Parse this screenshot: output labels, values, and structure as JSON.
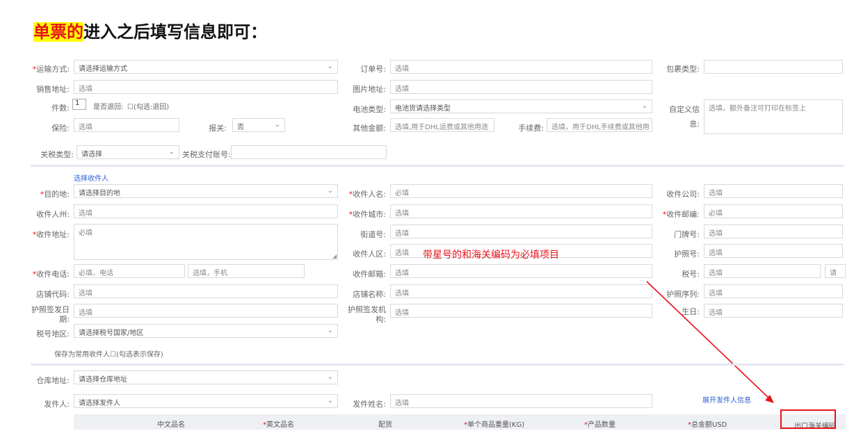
{
  "headline": {
    "highlight": "单票的",
    "rest": "进入之后填写信息即可："
  },
  "star": "*",
  "row1": {
    "transport_label": "运输方式:",
    "transport_value": "请选择运输方式",
    "order_label": "订单号:",
    "order_value": "选填",
    "package_label": "包裹类型:"
  },
  "row2": {
    "sales_label": "销售地址:",
    "sales_value": "选填",
    "image_label": "图片地址:",
    "image_value": "选填"
  },
  "row3": {
    "count_label": "件数:",
    "count_value": "1",
    "return_label": "是否退回:",
    "return_check": "☐(勾选:退回)",
    "battery_label": "电池类型:",
    "battery_value": "电池货请选择类型",
    "custom_label_1": "自定义信",
    "custom_label_2": "息:",
    "custom_value": "选填，额外备注可打印在标签上"
  },
  "row4": {
    "insurance_label": "保险:",
    "insurance_value": "选填",
    "declare_label": "报关:",
    "declare_value": "否",
    "other_label": "其他金额:",
    "other_value": "选填,用于DHL运费或其他用途",
    "fee_label": "手续费:",
    "fee_value": "选填，用于DHL手续费或其他用"
  },
  "row5": {
    "tax_type_label": "关税类型:",
    "tax_type_value": "请选择",
    "tax_account_label": "关税支付账号:"
  },
  "recipient": {
    "choose_link": "选择收件人",
    "dest_label": "目的地:",
    "dest_value": "请选择目的地",
    "name_label": "收件人名:",
    "name_value": "必填",
    "company_label": "收件公司:",
    "company_value": "选填",
    "state_label": "收件人州:",
    "state_value": "选填",
    "city_label": "收件城市:",
    "city_value": "选填",
    "zip_label": "收件邮编:",
    "zip_value": "必填",
    "addr_label": "收件地址:",
    "addr_value": "必填",
    "street_label": "街道号:",
    "street_value": "选填",
    "door_label": "门牌号:",
    "door_value": "选填",
    "district_label": "收件人区:",
    "district_value": "选填",
    "passport_label": "护照号:",
    "passport_value": "选填",
    "phone_label": "收件电话:",
    "phone_value": "必填，电话",
    "mobile_value": "选填，手机",
    "email_label": "收件邮箱:",
    "email_value": "选填",
    "taxno_label": "税号:",
    "taxno_value": "选填",
    "taxno_extra": "请",
    "shopcode_label": "店铺代码:",
    "shopcode_value": "选填",
    "shopname_label": "店铺名称:",
    "shopname_value": "选填",
    "passport_seq_label": "护照序列:",
    "passport_seq_value": "选填",
    "issue_date_label_1": "护照签发日",
    "issue_date_label_2": "期:",
    "issue_date_value": "选填",
    "issue_org_label_1": "护照签发机",
    "issue_org_label_2": "构:",
    "issue_org_value": "选填",
    "birthday_label": "生日:",
    "birthday_value": "选填",
    "taxregion_label": "税号地区:",
    "taxregion_value": "请选择税号国家/地区",
    "save_common": "保存为常用收件人☐(勾选表示保存)"
  },
  "annotation": "带星号的和海关编码为必填项目",
  "sender": {
    "warehouse_label": "仓库地址:",
    "warehouse_value": "请选择仓库地址",
    "sender_label": "发件人:",
    "sender_value": "请选择发件人",
    "sender_name_label": "发件姓名:",
    "sender_name_value": "选填",
    "expand_link": "展开发件人信息"
  },
  "table": {
    "cn_name": "中文品名",
    "en_name": "英文品名",
    "match": "配货",
    "weight": "单个商品重量(KG)",
    "qty": "产品数量",
    "total": "总金额USD",
    "hs": "出口海关编码"
  },
  "colors": {
    "required": "#e8121a",
    "link": "#2d5fd3",
    "highlight": "#ffff00"
  }
}
